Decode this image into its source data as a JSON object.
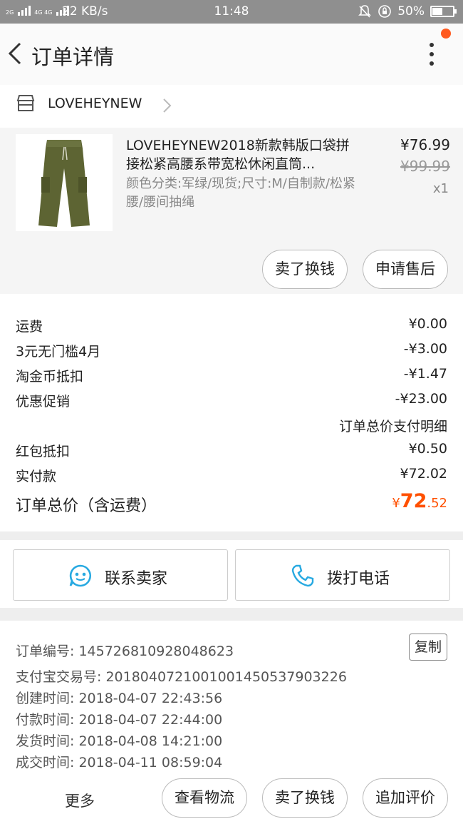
{
  "status_bar": {
    "network_a": "2G",
    "network_b": "4G 4G",
    "speed": "22 KB/s",
    "time": "11:48",
    "battery": "50%",
    "battery_level": 0.5
  },
  "nav": {
    "title": "订单详情"
  },
  "shop": {
    "name": "LOVEHEYNEW"
  },
  "item": {
    "title": "LOVEHEYNEW2018新款韩版口袋拼接松紧高腰系带宽松休闲直筒...",
    "spec": "颜色分类:军绿/现货;尺寸:M/自制款/松紧腰/腰间抽绳",
    "price": "¥76.99",
    "original_price": "¥99.99",
    "quantity": "x1",
    "btn_sell": "卖了换钱",
    "btn_aftersale": "申请售后"
  },
  "fees": {
    "shipping_label": "运费",
    "shipping_value": "¥0.00",
    "coupon_label": "3元无门槛4月",
    "coupon_value": "-¥3.00",
    "coin_label": "淘金币抵扣",
    "coin_value": "-¥1.47",
    "promo_label": "优惠促销",
    "promo_value": "-¥23.00",
    "detail_link": "订单总价支付明细",
    "redpacket_label": "红包抵扣",
    "redpacket_value": "¥0.50",
    "paid_label": "实付款",
    "paid_value": "¥72.02",
    "total_label": "订单总价（含运费）",
    "total_currency": "¥",
    "total_int": "72",
    "total_dec": ".52"
  },
  "contact": {
    "seller": "联系卖家",
    "phone": "拨打电话"
  },
  "order_info": {
    "order_no": "订单编号: 145726810928048623",
    "copy": "复制",
    "alipay_no": "支付宝交易号: 2018040721001001450537903226",
    "created": "创建时间: 2018-04-07 22:43:56",
    "paid": "付款时间: 2018-04-07 22:44:00",
    "shipped": "发货时间: 2018-04-08 14:21:00",
    "completed": "成交时间: 2018-04-11 08:59:04"
  },
  "bottom_bar": {
    "more": "更多",
    "logistics": "查看物流",
    "sell": "卖了换钱",
    "review": "追加评价"
  },
  "colors": {
    "accent": "#ff5000",
    "blue_icon": "#27a9e1",
    "status_bar": "#8f8f8f"
  }
}
